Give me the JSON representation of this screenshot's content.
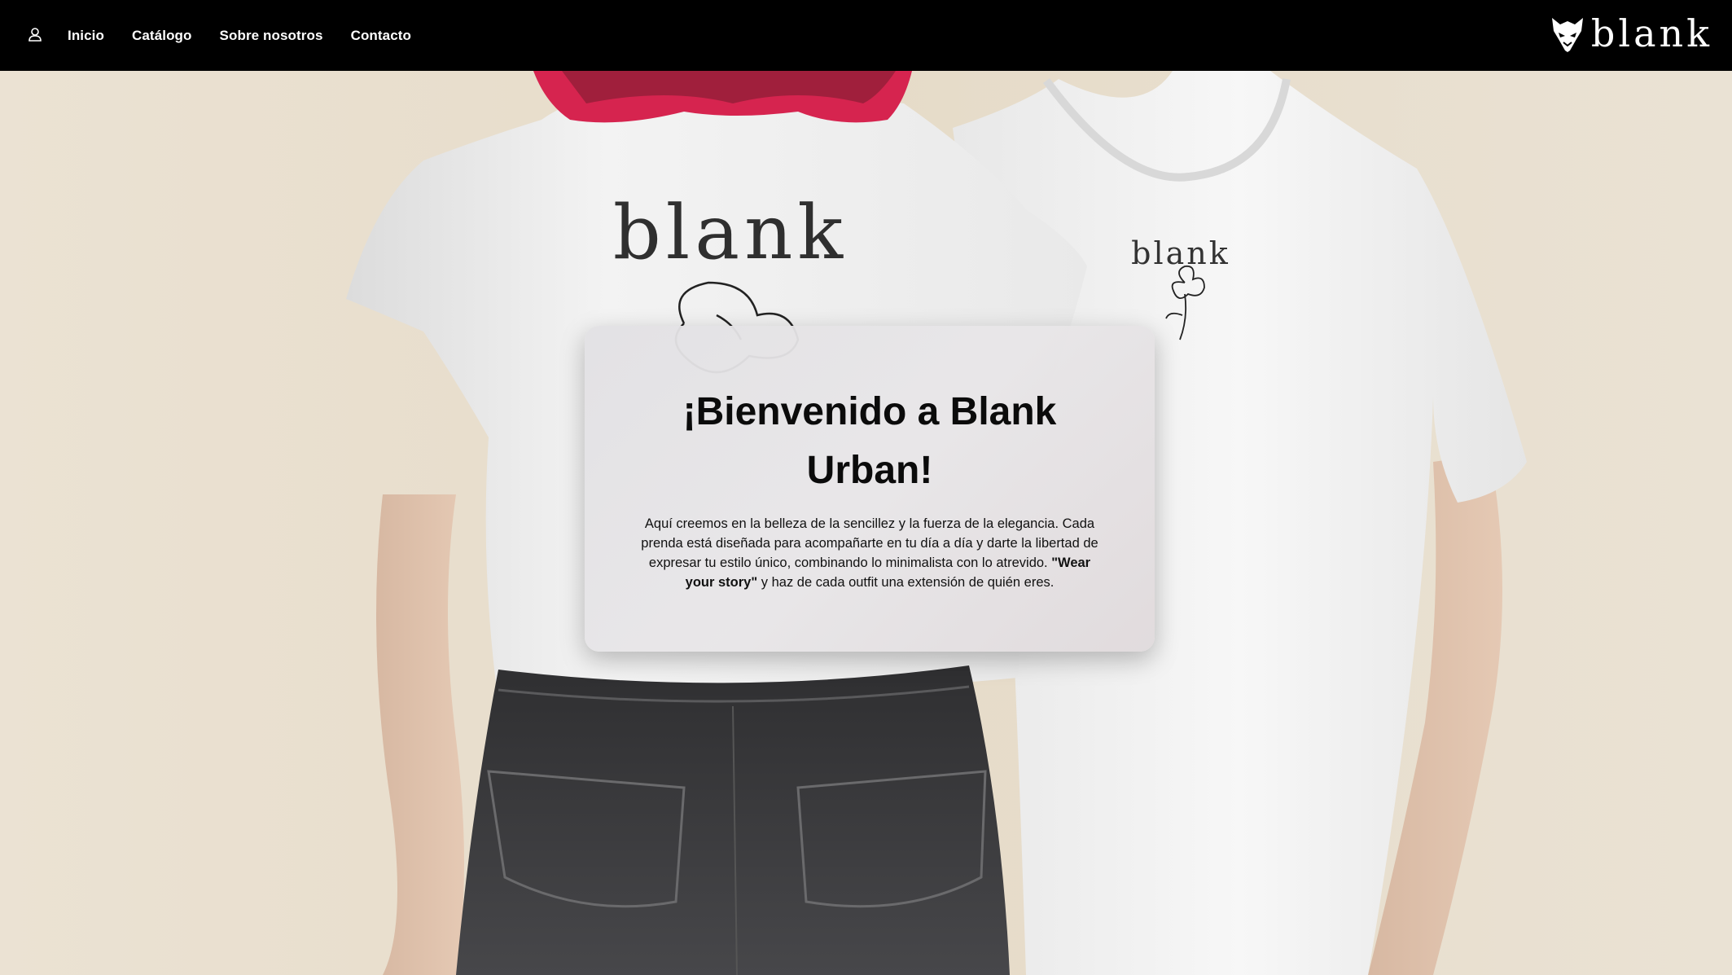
{
  "navbar": {
    "user_icon": "user-icon",
    "links": [
      "Inicio",
      "Catálogo",
      "Sobre nosotros",
      "Contacto"
    ],
    "logo_text": "blank",
    "logo_icon": "fox-head-logo"
  },
  "hero": {
    "shirt_print_left": "blank",
    "shirt_print_right": "blank"
  },
  "welcome": {
    "title": "¡Bienvenido a Blank Urban!",
    "text_before": "Aquí creemos en la belleza de la sencillez y la fuerza de la elegancia. Cada prenda está diseñada para acompañarte en tu día a día y darte la libertad de expresar tu estilo único, combinando lo minimalista con lo atrevido. ",
    "text_bold": "\"Wear your story\"",
    "text_after": " y haz de cada outfit una extensión de quién eres."
  },
  "colors": {
    "navbar_bg": "#000000",
    "nav_text": "#ffffff",
    "backdrop": "#e6dccb",
    "card_bg": "#e2e1e4",
    "hair": "#e2335a",
    "denim": "#3a3a3c"
  }
}
